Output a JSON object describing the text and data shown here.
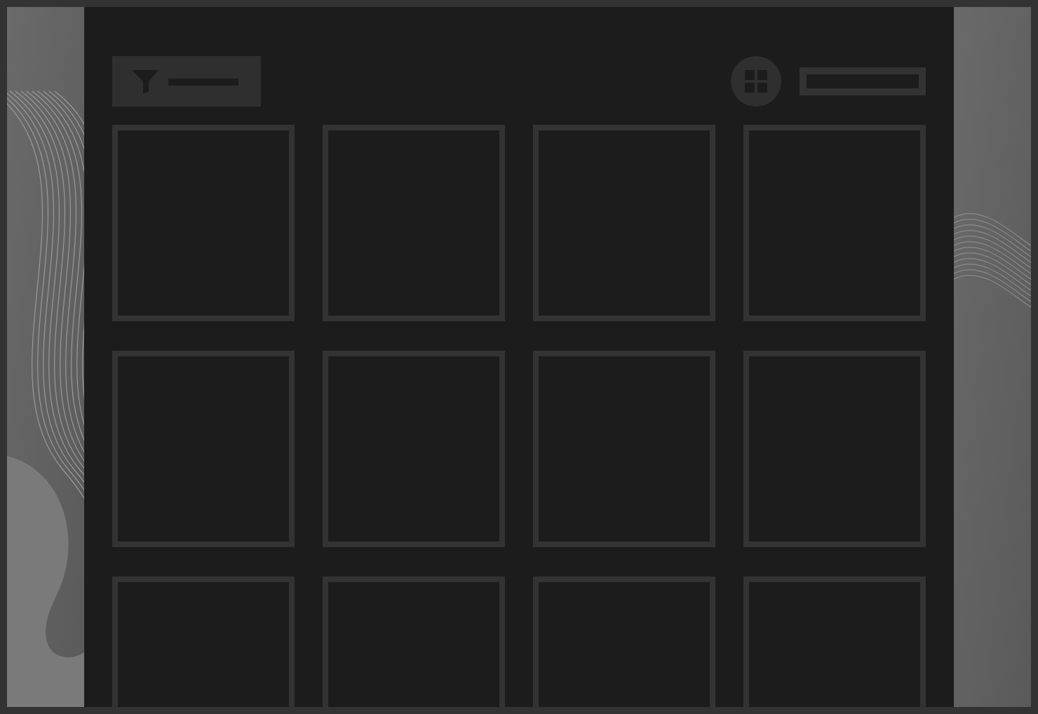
{
  "toolbar": [
    {
      "kind": "filter"
    },
    {
      "kind": "spacer"
    },
    {
      "kind": "grid_view"
    },
    {
      "kind": "search"
    }
  ],
  "tiles": [
    {
      "kind": "empty"
    },
    {
      "kind": "empty"
    },
    {
      "kind": "empty"
    },
    {
      "kind": "empty"
    },
    {
      "kind": "empty"
    },
    {
      "kind": "empty"
    },
    {
      "kind": "empty"
    },
    {
      "kind": "empty"
    },
    {
      "kind": "empty"
    },
    {
      "kind": "empty"
    },
    {
      "kind": "empty"
    },
    {
      "kind": "empty"
    }
  ]
}
